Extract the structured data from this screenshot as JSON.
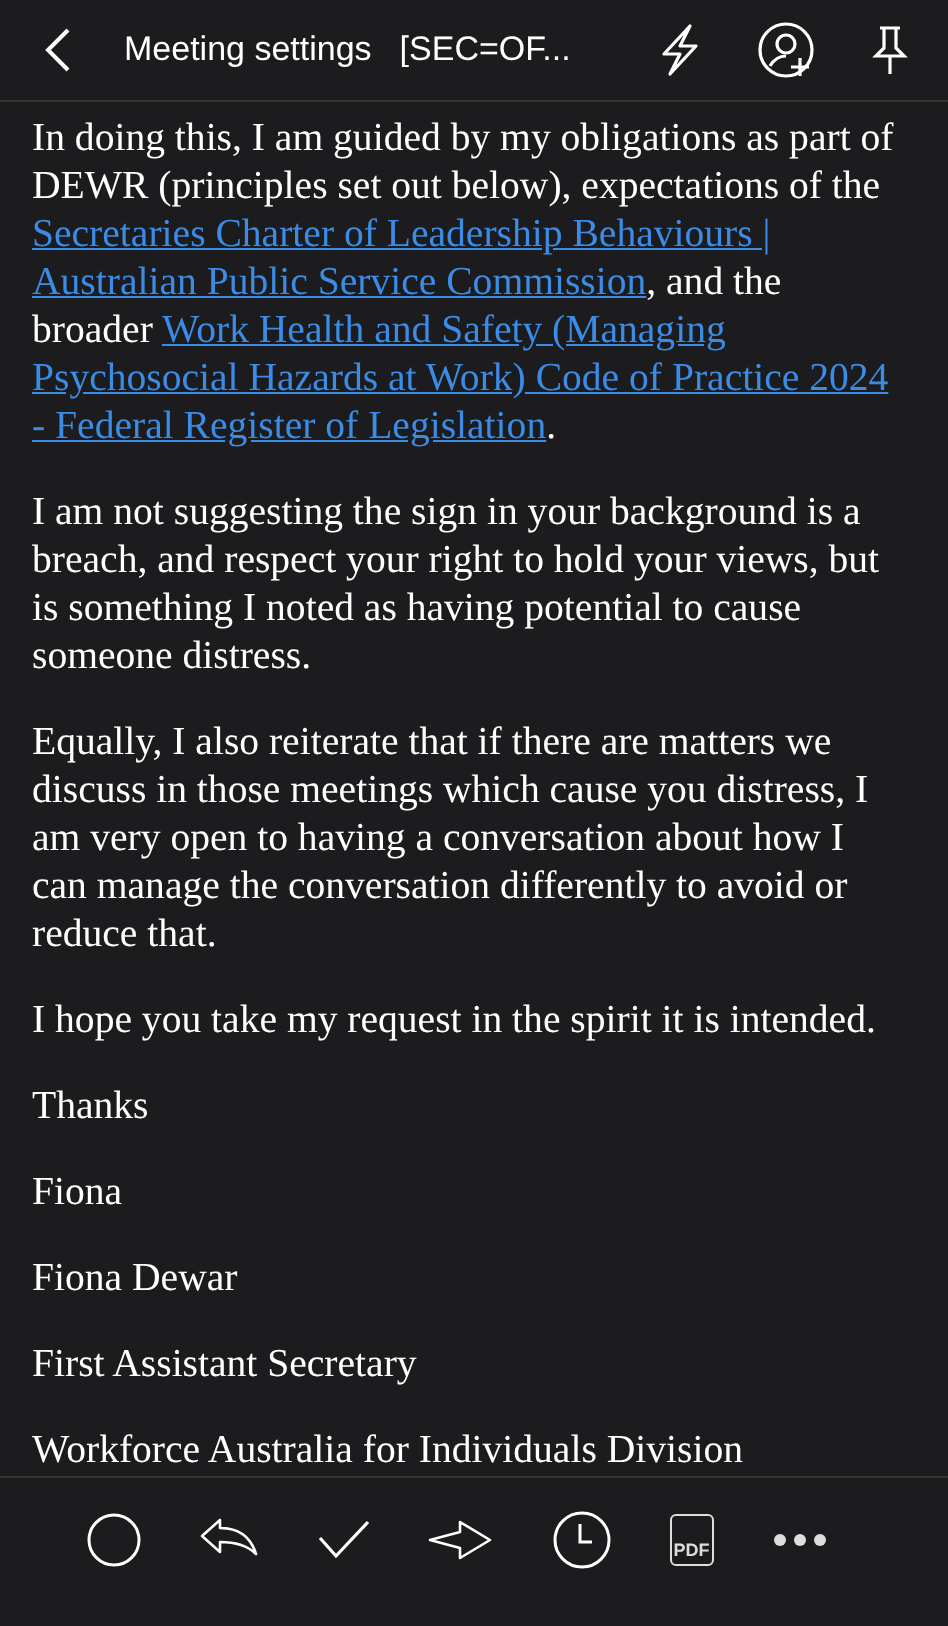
{
  "header": {
    "title": "Meeting settings",
    "subject": "[SEC=OF..."
  },
  "paragraphs": [
    {
      "kind": "lines",
      "lines": [
        [
          {
            "text": "In doing this, I am guided by my obligations as part of",
            "kind": "plain"
          }
        ],
        [
          {
            "text": "DEWR (principles set out below), expectations of the",
            "kind": "plain"
          }
        ],
        [
          {
            "text": "Secretaries Charter of Leadership Behaviours |",
            "kind": "link"
          }
        ],
        [
          {
            "text": "Australian Public Service Commission",
            "kind": "link"
          },
          {
            "text": ", and the",
            "kind": "plain"
          }
        ],
        [
          {
            "text": "broader ",
            "kind": "plain"
          },
          {
            "text": "Work Health and Safety (Managing",
            "kind": "link"
          }
        ],
        [
          {
            "text": "Psychosocial Hazards at Work) Code of Practice 2024",
            "kind": "link"
          }
        ],
        [
          {
            "text": "- Federal Register of Legislation",
            "kind": "link"
          },
          {
            "text": ".",
            "kind": "plain"
          }
        ]
      ]
    },
    {
      "kind": "text",
      "text": "I am not suggesting the sign in your background is a breach, and respect your right to hold your views, but is something I noted as having potential to cause someone distress."
    },
    {
      "kind": "text",
      "text": "Equally, I also reiterate that if there are matters we discuss in those meetings which cause you distress, I am very open to having a conversation about how I can manage the conversation differently to avoid or reduce that."
    },
    {
      "kind": "text",
      "text": "I hope you take my request in the spirit it is intended."
    },
    {
      "kind": "text",
      "text": "Thanks"
    },
    {
      "kind": "text",
      "text": "Fiona"
    },
    {
      "kind": "text",
      "text": "Fiona Dewar"
    },
    {
      "kind": "text",
      "text": "First Assistant Secretary"
    },
    {
      "kind": "text",
      "text": "Workforce Australia for Individuals Division"
    }
  ],
  "toolbar": {
    "pdf_label": "PDF"
  }
}
